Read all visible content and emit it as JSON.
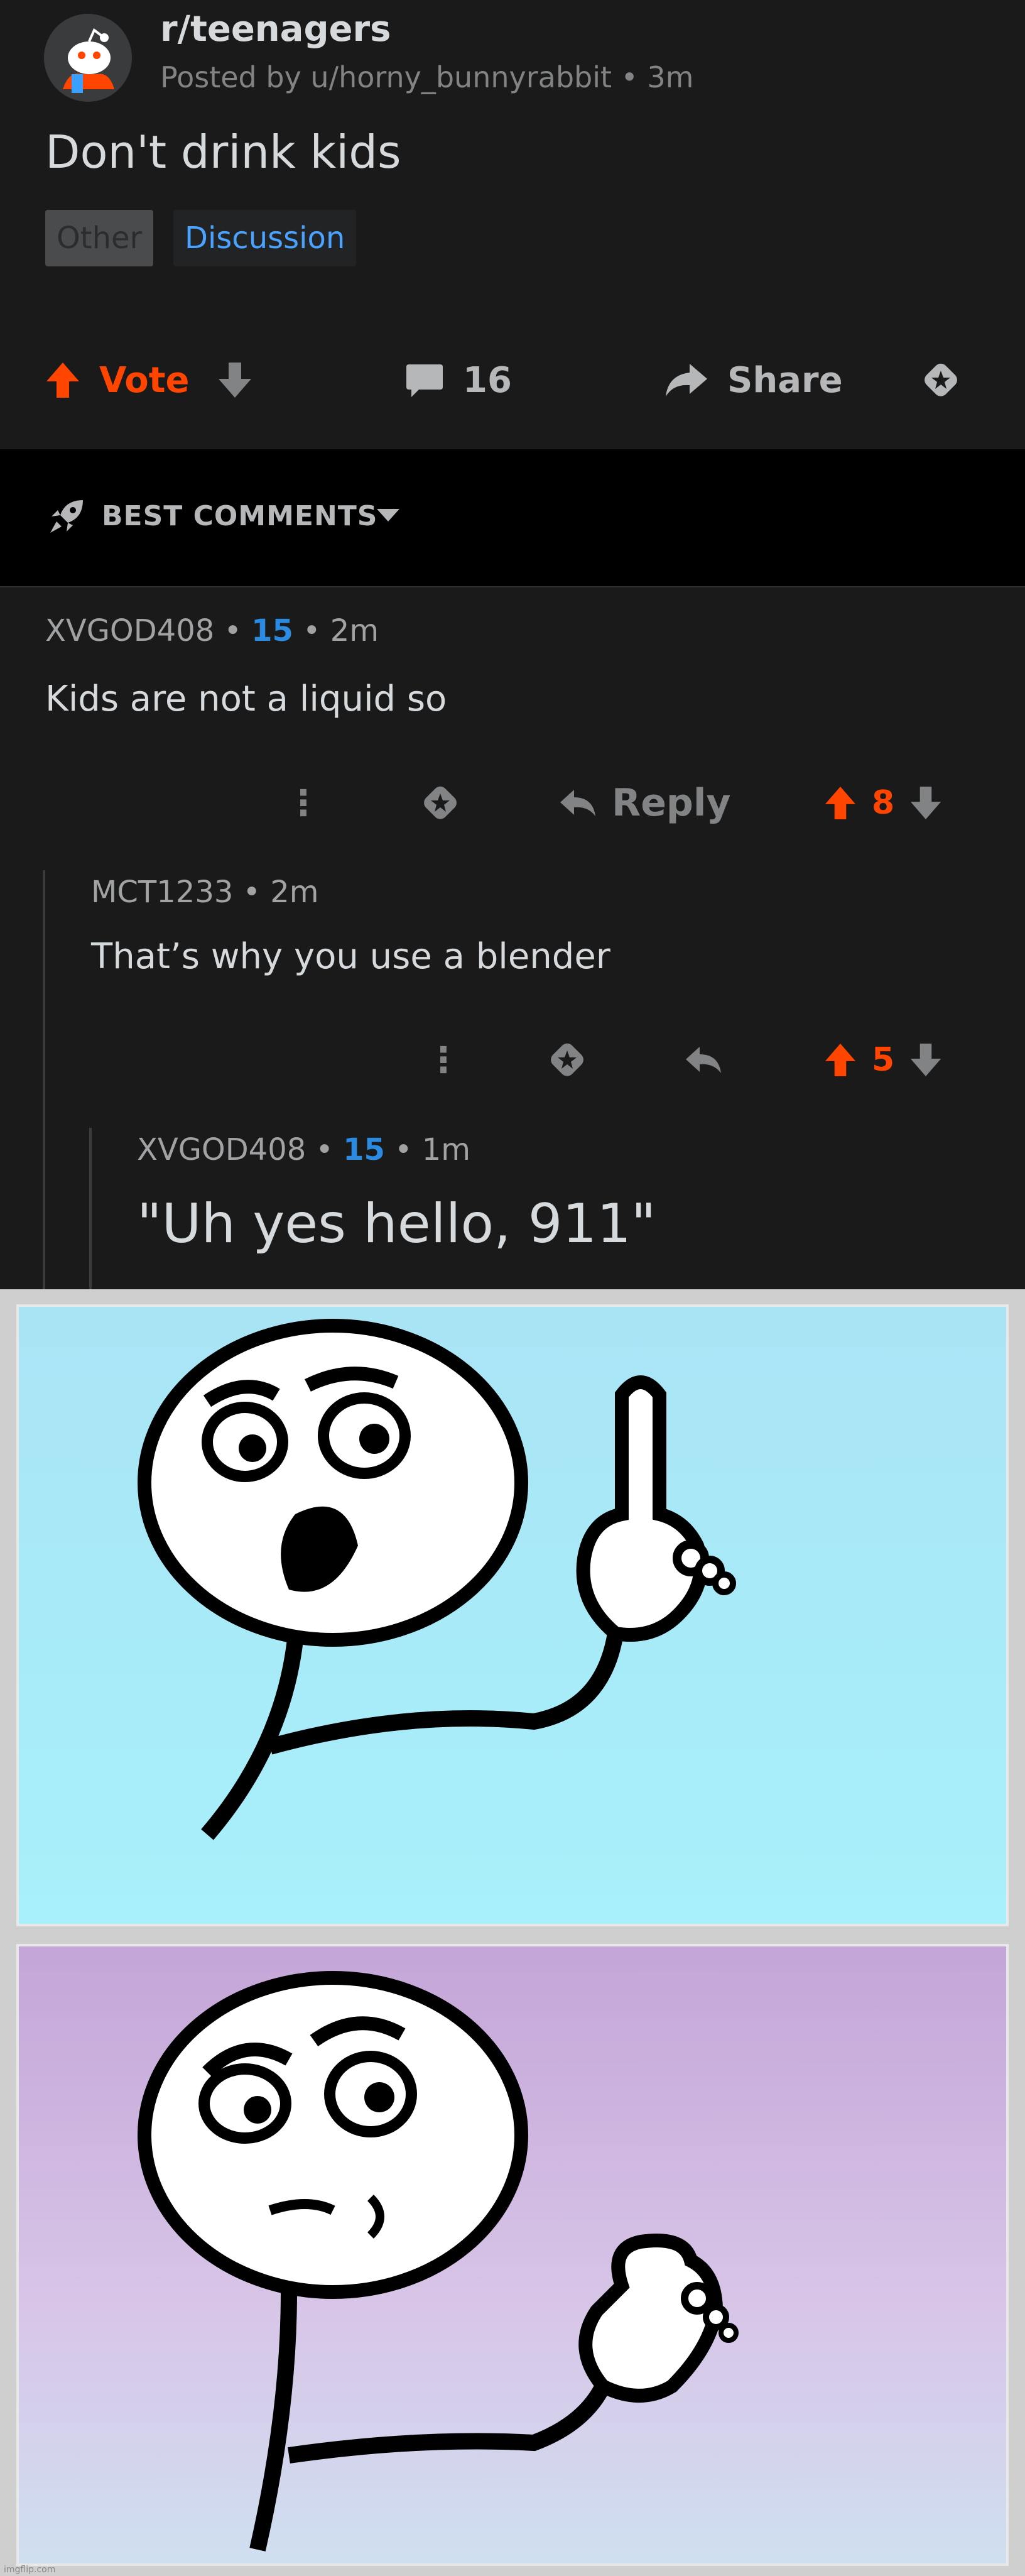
{
  "post": {
    "subreddit": "r/teenagers",
    "posted_by": "Posted by u/horny_bunnyrabbit • 3m",
    "title": "Don't drink kids",
    "flairs": [
      "Other",
      "Discussion"
    ]
  },
  "actions": {
    "vote_label": "Vote",
    "comment_count": "16",
    "share_label": "Share"
  },
  "sort": {
    "label": "BEST COMMENTS"
  },
  "comments": [
    {
      "author": "XVGOD408",
      "score": "15",
      "age": "2m",
      "body": "Kids are not a liquid so",
      "reply_label": "Reply",
      "votes": "8"
    },
    {
      "author": "MCT1233",
      "age": "2m",
      "body": "That’s why you use a blender",
      "votes": "5"
    },
    {
      "author": "XVGOD408",
      "score": "15",
      "age": "1m",
      "body": "\"Uh yes hello, 911\""
    }
  ],
  "meme": {
    "watermark": "imgflip.com"
  },
  "colors": {
    "upvote": "#ff4500",
    "score": "#2b8be0",
    "flair_discussion": "#4aa3ff",
    "background": "#1a1a1b"
  },
  "icons": [
    "snoo-avatar-icon",
    "upvote-icon",
    "downvote-icon",
    "comment-icon",
    "share-icon",
    "award-icon",
    "rocket-icon",
    "caret-down-icon",
    "more-icon",
    "reply-icon"
  ]
}
